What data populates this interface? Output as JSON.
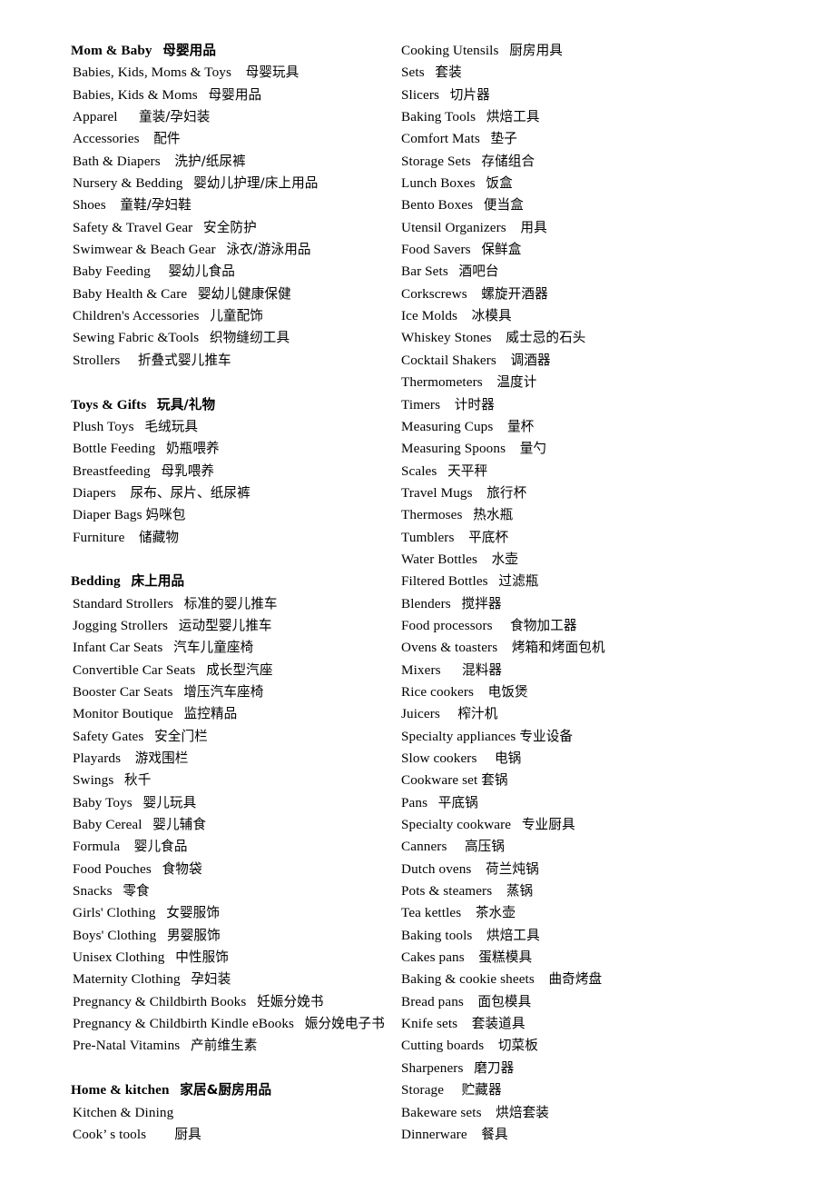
{
  "document": {
    "type": "bilingual-category-glossary",
    "columns": [
      {
        "name": "left-column",
        "blocks": [
          {
            "kind": "section",
            "heading": {
              "en": "Mom & Baby",
              "zh": "母婴用品",
              "gap": "   "
            },
            "items": [
              {
                "en": "Babies, Kids, Moms & Toys",
                "gap": "    ",
                "zh": "母婴玩具"
              },
              {
                "en": "Babies, Kids & Moms",
                "gap": "   ",
                "zh": "母婴用品"
              },
              {
                "en": "Apparel",
                "gap": "      ",
                "zh": "童装/孕妇装"
              },
              {
                "en": "Accessories",
                "gap": "    ",
                "zh": "配件"
              },
              {
                "en": "Bath & Diapers",
                "gap": "    ",
                "zh": "洗护/纸尿裤"
              },
              {
                "en": "Nursery & Bedding",
                "gap": "   ",
                "zh": "婴幼儿护理/床上用品"
              },
              {
                "en": "Shoes",
                "gap": "    ",
                "zh": "童鞋/孕妇鞋"
              },
              {
                "en": "Safety & Travel Gear",
                "gap": "   ",
                "zh": "安全防护"
              },
              {
                "en": "Swimwear & Beach Gear",
                "gap": "   ",
                "zh": "泳衣/游泳用品"
              },
              {
                "en": "Baby Feeding",
                "gap": "     ",
                "zh": "婴幼儿食品"
              },
              {
                "en": "Baby Health & Care",
                "gap": "   ",
                "zh": "婴幼儿健康保健"
              },
              {
                "en": "Children's Accessories",
                "gap": "   ",
                "zh": "儿童配饰"
              },
              {
                "en": "Sewing Fabric &Tools",
                "gap": "   ",
                "zh": "织物缝纫工具"
              },
              {
                "en": "Strollers",
                "gap": "     ",
                "zh": "折叠式婴儿推车"
              }
            ]
          },
          {
            "kind": "section",
            "heading": {
              "en": "Toys & Gifts",
              "gap": "   ",
              "zh": "玩具/礼物"
            },
            "items": [
              {
                "en": "Plush Toys",
                "gap": "   ",
                "zh": "毛绒玩具"
              },
              {
                "en": "Bottle Feeding",
                "gap": "   ",
                "zh": "奶瓶喂养"
              },
              {
                "en": "Breastfeeding",
                "gap": "   ",
                "zh": "母乳喂养"
              },
              {
                "en": "Diapers",
                "gap": "    ",
                "zh": "尿布、尿片、纸尿裤"
              },
              {
                "en": "Diaper Bags",
                "gap": " ",
                "zh": "妈咪包"
              },
              {
                "en": "Furniture",
                "gap": "    ",
                "zh": "储藏物"
              }
            ]
          },
          {
            "kind": "section",
            "heading": {
              "en": "Bedding",
              "gap": "   ",
              "zh": "床上用品"
            },
            "items": [
              {
                "en": "Standard Strollers",
                "gap": "   ",
                "zh": "标准的婴儿推车"
              },
              {
                "en": "Jogging Strollers",
                "gap": "   ",
                "zh": "运动型婴儿推车"
              },
              {
                "en": "Infant Car Seats",
                "gap": "   ",
                "zh": "汽车儿童座椅"
              },
              {
                "en": "Convertible Car Seats",
                "gap": "   ",
                "zh": "成长型汽座"
              },
              {
                "en": "Booster Car Seats",
                "gap": "   ",
                "zh": "增压汽车座椅"
              },
              {
                "en": "Monitor Boutique",
                "gap": "   ",
                "zh": "监控精品"
              },
              {
                "en": "Safety Gates",
                "gap": "   ",
                "zh": "安全门栏"
              },
              {
                "en": "Playards",
                "gap": "    ",
                "zh": "游戏围栏"
              },
              {
                "en": "Swings",
                "gap": "   ",
                "zh": "秋千"
              },
              {
                "en": "Baby Toys",
                "gap": "   ",
                "zh": "婴儿玩具"
              },
              {
                "en": "Baby Cereal",
                "gap": "   ",
                "zh": "婴儿辅食"
              },
              {
                "en": "Formula",
                "gap": "    ",
                "zh": "婴儿食品"
              },
              {
                "en": "Food Pouches",
                "gap": "   ",
                "zh": "食物袋"
              },
              {
                "en": "Snacks",
                "gap": "   ",
                "zh": "零食"
              },
              {
                "en": "Girls' Clothing",
                "gap": "   ",
                "zh": "女婴服饰"
              },
              {
                "en": "Boys' Clothing",
                "gap": "   ",
                "zh": "男婴服饰"
              },
              {
                "en": "Unisex Clothing",
                "gap": "   ",
                "zh": "中性服饰"
              },
              {
                "en": "Maternity Clothing",
                "gap": "   ",
                "zh": "孕妇装"
              },
              {
                "en": "Pregnancy & Childbirth Books",
                "gap": "   ",
                "zh": "妊娠分娩书"
              },
              {
                "en": "Pregnancy & Childbirth Kindle eBooks",
                "gap": "   ",
                "zh": "娠分娩电子书"
              },
              {
                "en": "Pre-Natal Vitamins",
                "gap": "   ",
                "zh": "产前维生素"
              }
            ]
          },
          {
            "kind": "section",
            "heading": {
              "en": "Home & kitchen",
              "gap": "   ",
              "zh": "家居&厨房用品"
            },
            "items": [
              {
                "en": "Kitchen & Dining",
                "gap": "",
                "zh": ""
              },
              {
                "en": "Cook’ s tools",
                "gap": "        ",
                "zh": "厨具"
              }
            ]
          }
        ]
      },
      {
        "name": "right-column",
        "blocks": [
          {
            "kind": "list",
            "items": [
              {
                "en": "Cooking Utensils",
                "gap": "   ",
                "zh": "厨房用具"
              },
              {
                "en": "Sets",
                "gap": "   ",
                "zh": "套装"
              },
              {
                "en": "Slicers",
                "gap": "   ",
                "zh": "切片器"
              },
              {
                "en": "Baking Tools",
                "gap": "   ",
                "zh": "烘焙工具"
              },
              {
                "en": "Comfort Mats",
                "gap": "   ",
                "zh": "垫子"
              },
              {
                "en": "Storage Sets",
                "gap": "   ",
                "zh": "存储组合"
              },
              {
                "en": "Lunch Boxes",
                "gap": "   ",
                "zh": "饭盒"
              },
              {
                "en": "Bento Boxes",
                "gap": "   ",
                "zh": "便当盒"
              },
              {
                "en": "Utensil Organizers",
                "gap": "    ",
                "zh": "用具"
              },
              {
                "en": "Food Savers",
                "gap": "   ",
                "zh": "保鲜盒"
              },
              {
                "en": "Bar Sets",
                "gap": "   ",
                "zh": "酒吧台"
              },
              {
                "en": "Corkscrews",
                "gap": "    ",
                "zh": "螺旋开酒器"
              },
              {
                "en": "Ice Molds",
                "gap": "    ",
                "zh": "冰模具"
              },
              {
                "en": "Whiskey Stones",
                "gap": "    ",
                "zh": "威士忌的石头"
              },
              {
                "en": "Cocktail Shakers",
                "gap": "    ",
                "zh": "调酒器"
              },
              {
                "en": "Thermometers",
                "gap": "    ",
                "zh": "温度计"
              },
              {
                "en": "Timers",
                "gap": "    ",
                "zh": "计时器"
              },
              {
                "en": "Measuring Cups",
                "gap": "    ",
                "zh": "量杯"
              },
              {
                "en": "Measuring Spoons",
                "gap": "    ",
                "zh": "量勺"
              },
              {
                "en": "Scales",
                "gap": "   ",
                "zh": "天平秤"
              },
              {
                "en": "Travel Mugs",
                "gap": "    ",
                "zh": "旅行杯"
              },
              {
                "en": "Thermoses",
                "gap": "   ",
                "zh": "热水瓶"
              },
              {
                "en": "Tumblers",
                "gap": "    ",
                "zh": "平底杯"
              },
              {
                "en": "Water Bottles",
                "gap": "    ",
                "zh": "水壶"
              },
              {
                "en": "Filtered Bottles",
                "gap": "   ",
                "zh": "过滤瓶"
              },
              {
                "en": "Blenders",
                "gap": "   ",
                "zh": "搅拌器"
              },
              {
                "en": "Food processors",
                "gap": "     ",
                "zh": "食物加工器"
              },
              {
                "en": "Ovens & toasters",
                "gap": "    ",
                "zh": "烤箱和烤面包机"
              },
              {
                "en": "Mixers",
                "gap": "      ",
                "zh": "混料器"
              },
              {
                "en": "Rice cookers",
                "gap": "    ",
                "zh": "电饭煲"
              },
              {
                "en": "Juicers",
                "gap": "     ",
                "zh": "榨汁机"
              },
              {
                "en": "Specialty appliances",
                "gap": " ",
                "zh": "专业设备"
              },
              {
                "en": "Slow cookers",
                "gap": "     ",
                "zh": "电锅"
              },
              {
                "en": "Cookware set",
                "gap": " ",
                "zh": "套锅"
              },
              {
                "en": "Pans",
                "gap": "   ",
                "zh": "平底锅"
              },
              {
                "en": "Specialty cookware",
                "gap": "   ",
                "zh": "专业厨具"
              },
              {
                "en": "Canners",
                "gap": "     ",
                "zh": "高压锅"
              },
              {
                "en": "Dutch ovens",
                "gap": "    ",
                "zh": "荷兰炖锅"
              },
              {
                "en": "Pots & steamers",
                "gap": "    ",
                "zh": "蒸锅"
              },
              {
                "en": "Tea kettles",
                "gap": "    ",
                "zh": "茶水壶"
              },
              {
                "en": "Baking tools",
                "gap": "    ",
                "zh": "烘焙工具"
              },
              {
                "en": "Cakes pans",
                "gap": "    ",
                "zh": "蛋糕模具"
              },
              {
                "en": "Baking & cookie sheets",
                "gap": "    ",
                "zh": "曲奇烤盘"
              },
              {
                "en": "Bread pans",
                "gap": "    ",
                "zh": "面包模具"
              },
              {
                "en": "Knife sets",
                "gap": "    ",
                "zh": "套装道具"
              },
              {
                "en": "Cutting boards",
                "gap": "    ",
                "zh": "切菜板"
              },
              {
                "en": "Sharpeners",
                "gap": "   ",
                "zh": "磨刀器"
              },
              {
                "en": "Storage",
                "gap": "     ",
                "zh": "贮藏器"
              },
              {
                "en": "Bakeware sets",
                "gap": "    ",
                "zh": "烘焙套装"
              },
              {
                "en": "Dinnerware",
                "gap": "    ",
                "zh": "餐具"
              }
            ]
          }
        ]
      }
    ]
  }
}
